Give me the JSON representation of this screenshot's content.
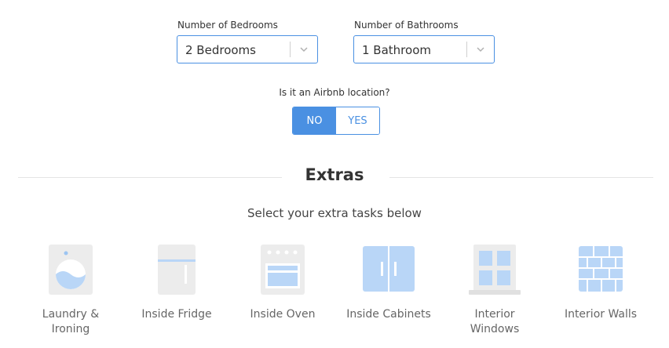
{
  "bedrooms": {
    "label": "Number of Bedrooms",
    "value": "2 Bedrooms"
  },
  "bathrooms": {
    "label": "Number of Bathrooms",
    "value": "1 Bathroom"
  },
  "airbnb": {
    "question": "Is it an Airbnb location?",
    "options": [
      "NO",
      "YES"
    ],
    "selected": "NO"
  },
  "extras": {
    "title": "Extras",
    "subtitle": "Select your extra tasks below",
    "items": [
      {
        "label_line1": "Laundry &",
        "label_line2": "Ironing",
        "icon": "washing-machine-icon"
      },
      {
        "label_line1": "Inside Fridge",
        "label_line2": "",
        "icon": "fridge-icon"
      },
      {
        "label_line1": "Inside Oven",
        "label_line2": "",
        "icon": "oven-icon"
      },
      {
        "label_line1": "Inside Cabinets",
        "label_line2": "",
        "icon": "cabinet-icon"
      },
      {
        "label_line1": "Interior",
        "label_line2": "Windows",
        "icon": "window-icon"
      },
      {
        "label_line1": "Interior Walls",
        "label_line2": "",
        "icon": "brick-wall-icon"
      }
    ]
  },
  "colors": {
    "accent": "#4a90e2",
    "icon_gray": "#ececec",
    "icon_blue": "#b9d6f7",
    "icon_blue_dark": "#9cc4f2"
  }
}
